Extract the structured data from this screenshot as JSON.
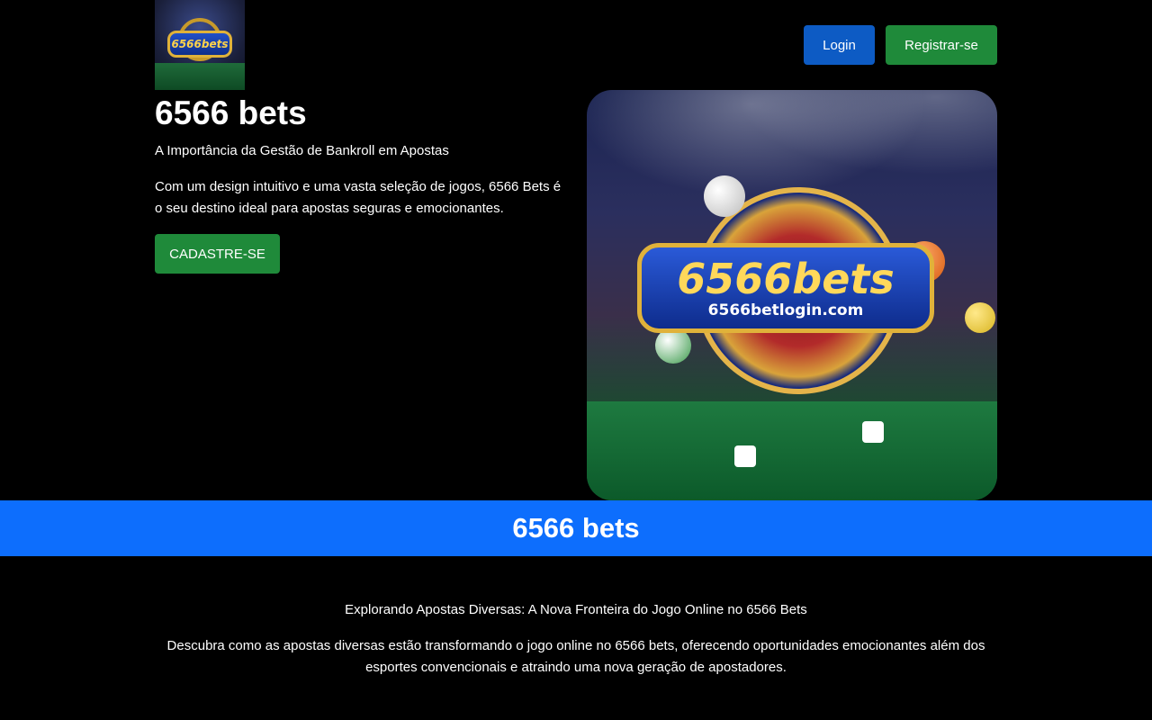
{
  "header": {
    "logo_brand": "6566bets",
    "login_label": "Login",
    "register_label": "Registrar-se"
  },
  "hero": {
    "title": "6566 bets",
    "subtitle": "A Importância da Gestão de Bankroll em Apostas",
    "description": "Com um design intuitivo e uma vasta seleção de jogos, 6566 Bets é o seu destino ideal para apostas seguras e emocionantes.",
    "cta_label": "CADASTRE-SE",
    "image_brand": "6566bets",
    "image_url": "6566betlogin.com"
  },
  "banner": {
    "title": "6566 bets"
  },
  "section": {
    "title": "Explorando Apostas Diversas: A Nova Fronteira do Jogo Online no 6566 Bets",
    "text": "Descubra como as apostas diversas estão transformando o jogo online no 6566 bets, oferecendo oportunidades emocionantes além dos esportes convencionais e atraindo uma nova geração de apostadores."
  },
  "colors": {
    "background": "#000000",
    "login_button": "#0d5bc4",
    "register_button": "#1f8a3a",
    "banner": "#0d6efd"
  }
}
